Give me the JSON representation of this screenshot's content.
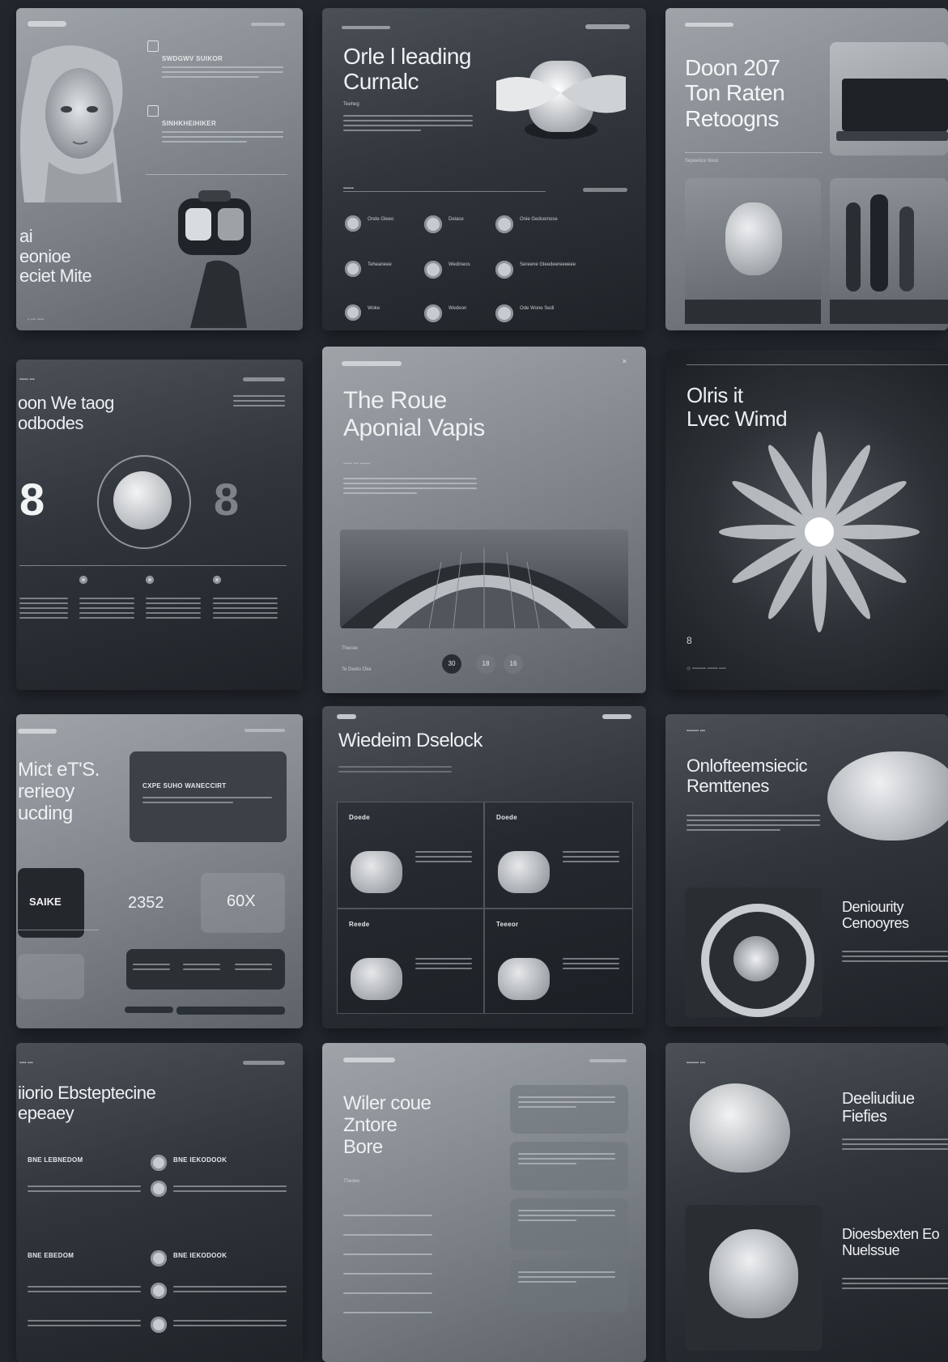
{
  "cards": {
    "c1": {
      "header_right": "",
      "section1": "SWDGWV SUIKOR",
      "section2": "SINHKHEIHIKER",
      "title": [
        "ai",
        "eonioe",
        "eciet Mite"
      ],
      "photo": "woman-portrait",
      "object": "vr-headset"
    },
    "c2": {
      "title": [
        "Orle l leading",
        "Curnalc"
      ],
      "label": "Teeheg",
      "features": [
        "Onde Gleeo",
        "Deiace",
        "Onie Gedcemose",
        "Teheaneee",
        "Wedineos",
        "Sereene Gleedeereeeeee",
        "Woke",
        "Wedeon",
        "Ode Wone Sedi"
      ]
    },
    "c3": {
      "title": [
        "Doon 207",
        "Ton Raten",
        "Retoogns"
      ],
      "label": "Sepeelice Wesi"
    },
    "c4": {
      "title": [
        "oon We taog",
        "odbodes"
      ],
      "digits": [
        "8",
        "8"
      ]
    },
    "c5": {
      "title": [
        "The Roue",
        "Aponial Vapis"
      ],
      "footer": "Thecee",
      "footer2": "Te Deeto Oke",
      "nums": [
        "30",
        "18",
        "16"
      ]
    },
    "c6": {
      "title": [
        "Olris it",
        "Lvec Wimd"
      ],
      "side_num": "8"
    },
    "c7": {
      "title": [
        "Mict eT'S.",
        "rerieoy",
        "ucding"
      ],
      "panel_title": "CXPE SUHO WANECCIRT",
      "stats": [
        "SAIKE",
        "2352",
        "60X"
      ]
    },
    "c8": {
      "title": "Wiedeim Dselock",
      "cells": [
        "Doede",
        "Doede",
        "Reede",
        "Teeeor"
      ]
    },
    "c9": {
      "title": [
        "Onlofteemsiecic",
        "Remttenes"
      ],
      "subtitle": [
        "Deniourity",
        "Cenooyres"
      ]
    },
    "c10": {
      "title": [
        "iiorio Ebsteptecine",
        "epeaey"
      ],
      "items": [
        "BNE LEBNEDOM",
        "BNE IEKODOOK",
        "BNE EBEDOM",
        "BNE IEKODOOK"
      ]
    },
    "c11": {
      "title": [
        "Wiler coue",
        "Zntore",
        "Bore"
      ],
      "label": "Thedee"
    },
    "c12": {
      "title": [
        "Deeliudiue",
        "Fiefies"
      ],
      "subtitle": [
        "Dioesbexten Eo",
        "Nuelssue"
      ]
    }
  },
  "colors": {
    "background": "#23272d",
    "text": "#eef0f2",
    "panel": "#3a4046"
  }
}
